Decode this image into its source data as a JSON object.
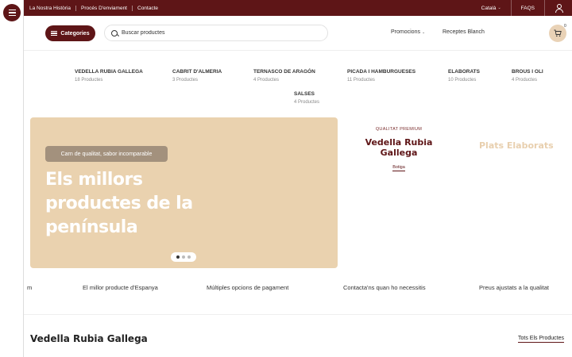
{
  "topbar": {
    "links": [
      "La Nostra Història",
      "Procés D'enviament",
      "Contacte"
    ],
    "language": "Català",
    "faqs": "FAQS"
  },
  "header": {
    "categories_label": "Categories",
    "search_placeholder": "Buscar productes",
    "promocions": "Promocions",
    "receptes": "Receptes Blanch",
    "cart_count": "0"
  },
  "categories": [
    {
      "name": "VEDELLA RUBIA GALLEGA",
      "count": "18 Productes"
    },
    {
      "name": "CABRIT D'ALMERIA",
      "count": "3 Productes"
    },
    {
      "name": "TERNASCO DE ARAGÓN",
      "count": "4 Productes"
    },
    {
      "name": "PICADA I HAMBURGUESES",
      "count": "11 Productes"
    },
    {
      "name": "ELABORATS",
      "count": "10 Productes"
    },
    {
      "name": "BROUS I OLI",
      "count": "4 Productes"
    },
    {
      "name": "SALSES",
      "count": "4 Productes"
    }
  ],
  "hero": {
    "badge": "Carn de qualitat, sabor incomparable",
    "title": "Els millors productes de la península",
    "bg_color": "#ead2af"
  },
  "premium": {
    "kicker": "QUALITAT PREMIUM",
    "title": "Vedella Rubia Gallega",
    "link": "Botiga"
  },
  "next_slide_title": "Plats Elaborats",
  "features": [
    "m",
    "El millor producte d'Espanya",
    "Múltiples opcions de pagament",
    "Contacta'ns quan ho necessitis",
    "Preus ajustats a la qualitat"
  ],
  "section": {
    "title": "Vedella Rubia Gallega",
    "all_link": "Tots Els Productes"
  },
  "colors": {
    "brand": "#5e1517",
    "hero": "#ead2af",
    "cart_bg": "#e9d2b6"
  }
}
